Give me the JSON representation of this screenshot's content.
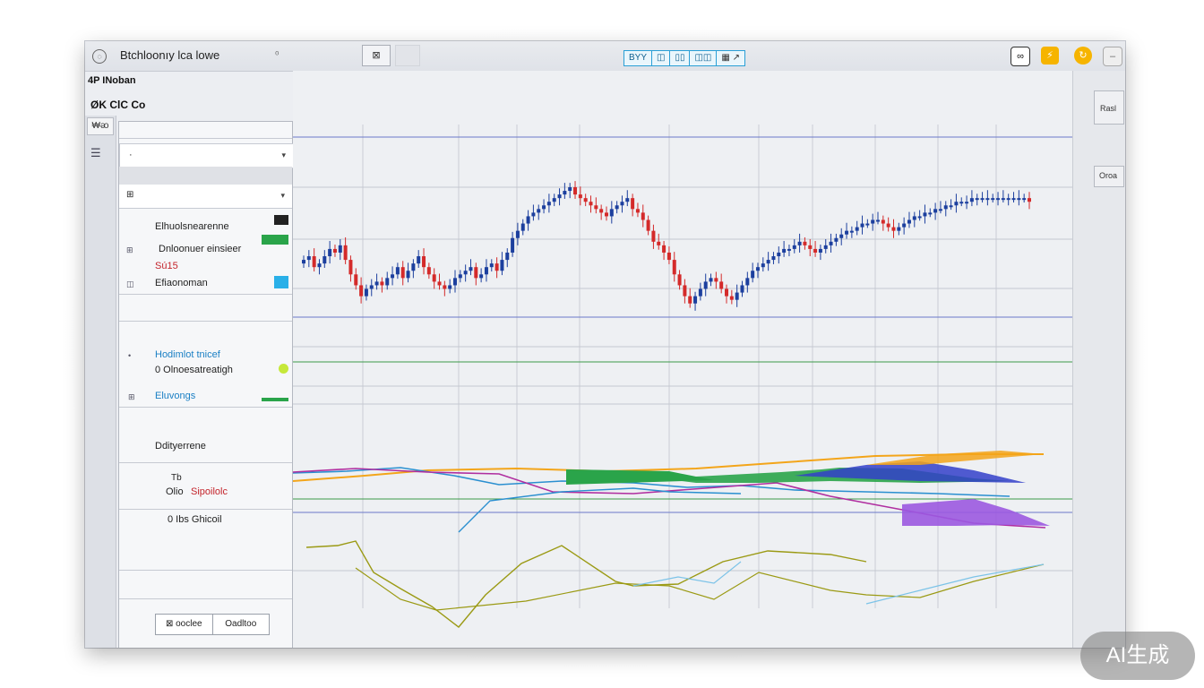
{
  "window": {
    "title": "Btchloonıy lca lowe",
    "title_small": "⁰",
    "title_box": "⊠",
    "toolbar_groups": [
      "BYY",
      "◫",
      "▯▯",
      "◫◫",
      "▦ ↗"
    ],
    "right_buttons": [
      "∞",
      "⚡",
      "↻",
      "–"
    ]
  },
  "left": {
    "header1": "4P INoban",
    "header2": "ØK ClC Co",
    "rail_tab": "₩ᴔ",
    "rail_icon": "☰",
    "fields": [
      {
        "text": "·",
        "arrow": "▾"
      },
      {
        "text": "⊞",
        "arrow": "▾"
      }
    ],
    "rows": [
      {
        "text": "Elhuolsnearenne",
        "icon": ""
      },
      {
        "text": "Dnloonuer einsieer",
        "icon": "⊞"
      },
      {
        "text": "Sú15",
        "icon": ""
      },
      {
        "text": "Efiaonoman",
        "icon": "◫"
      }
    ],
    "rows2": [
      {
        "text": "Hodimlot tnicef",
        "icon": "•"
      },
      {
        "text": "0 Olnoesatreatigh",
        "icon": ""
      },
      {
        "text": "Eluvongs",
        "icon": "⊞"
      },
      {
        "text": "Ddityerrene",
        "icon": ""
      },
      {
        "text": "Tb",
        "icon": ""
      },
      {
        "text": "Olio",
        "icon": ""
      },
      {
        "text": "Sipoilolc",
        "icon": ""
      },
      {
        "text": "0 Ibs Ghicoil",
        "icon": ""
      }
    ],
    "buttons": [
      "⊠ ooclee",
      "Oadltoo"
    ]
  },
  "right_panel": {
    "labels": [
      "Rasl",
      "Oroa"
    ]
  },
  "chart_data": {
    "type": "line",
    "title": "",
    "xlabel": "",
    "ylabel": "",
    "ylim": [
      0,
      100
    ],
    "x": [
      0,
      1,
      2,
      3,
      4,
      5,
      6,
      7,
      8,
      9,
      10,
      11,
      12,
      13,
      14,
      15,
      16,
      17,
      18,
      19,
      20,
      21,
      22,
      23,
      24,
      25,
      26,
      27,
      28,
      29,
      30,
      31,
      32,
      33,
      34,
      35,
      36,
      37,
      38,
      39,
      40,
      41,
      42,
      43,
      44,
      45,
      46,
      47,
      48,
      49,
      50,
      51,
      52,
      53,
      54,
      55,
      56,
      57,
      58,
      59,
      60,
      61,
      62,
      63,
      64,
      65,
      66,
      67,
      68,
      69,
      70,
      71,
      72,
      73,
      74,
      75,
      76,
      77,
      78,
      79,
      80,
      81,
      82,
      83,
      84,
      85,
      86,
      87,
      88,
      89,
      90,
      91,
      92,
      93,
      94,
      95,
      96,
      97,
      98,
      99,
      100,
      101,
      102,
      103,
      104,
      105,
      106,
      107,
      108,
      109,
      110,
      111,
      112,
      113,
      114,
      115,
      116,
      117,
      118,
      119,
      120,
      121,
      122,
      123,
      124,
      125,
      126,
      127,
      128,
      129,
      130,
      131,
      132,
      133,
      134,
      135,
      136,
      137,
      138,
      139
    ],
    "candles": {
      "close": [
        62,
        63,
        60,
        61,
        63,
        65,
        64,
        66,
        62,
        58,
        55,
        52,
        54,
        55,
        56,
        55,
        57,
        58,
        60,
        57,
        59,
        61,
        63,
        60,
        58,
        56,
        55,
        54,
        55,
        57,
        58,
        59,
        60,
        57,
        58,
        60,
        61,
        59,
        62,
        64,
        68,
        70,
        72,
        74,
        75,
        76,
        77,
        78,
        79,
        80,
        81,
        82,
        80,
        79,
        78,
        77,
        76,
        75,
        74,
        76,
        77,
        78,
        79,
        76,
        75,
        73,
        70,
        67,
        66,
        64,
        62,
        58,
        55,
        52,
        50,
        52,
        54,
        56,
        57,
        56,
        54,
        52,
        51,
        53,
        55,
        57,
        59,
        60,
        61,
        62,
        63,
        64,
        65,
        65,
        66,
        67,
        66,
        65,
        64,
        65,
        66,
        67,
        68,
        69,
        70,
        70,
        71,
        72,
        72,
        73,
        73,
        72,
        71,
        70,
        71,
        72,
        73,
        74,
        74,
        75,
        75,
        76,
        76,
        77,
        77,
        78,
        78,
        78,
        79,
        79,
        79,
        79,
        79,
        79,
        79,
        79,
        79,
        79,
        79,
        78
      ],
      "up_color": "#1c3f9e",
      "down_color": "#d42a2a"
    },
    "series": [
      {
        "name": "",
        "color": "#f3a51a"
      },
      {
        "name": "",
        "color": "#2a8fd0"
      },
      {
        "name": "",
        "color": "#b02ea0"
      },
      {
        "name": "",
        "color": "#2aa44a"
      },
      {
        "name": "",
        "color": "#3340c9"
      },
      {
        "name": "",
        "color": "#9b59e0"
      },
      {
        "name": "",
        "color": "#9b9a14"
      },
      {
        "name": "",
        "color": "#7cc3e8"
      }
    ],
    "grid": true,
    "legend": "none"
  },
  "watermark": "AI生成"
}
